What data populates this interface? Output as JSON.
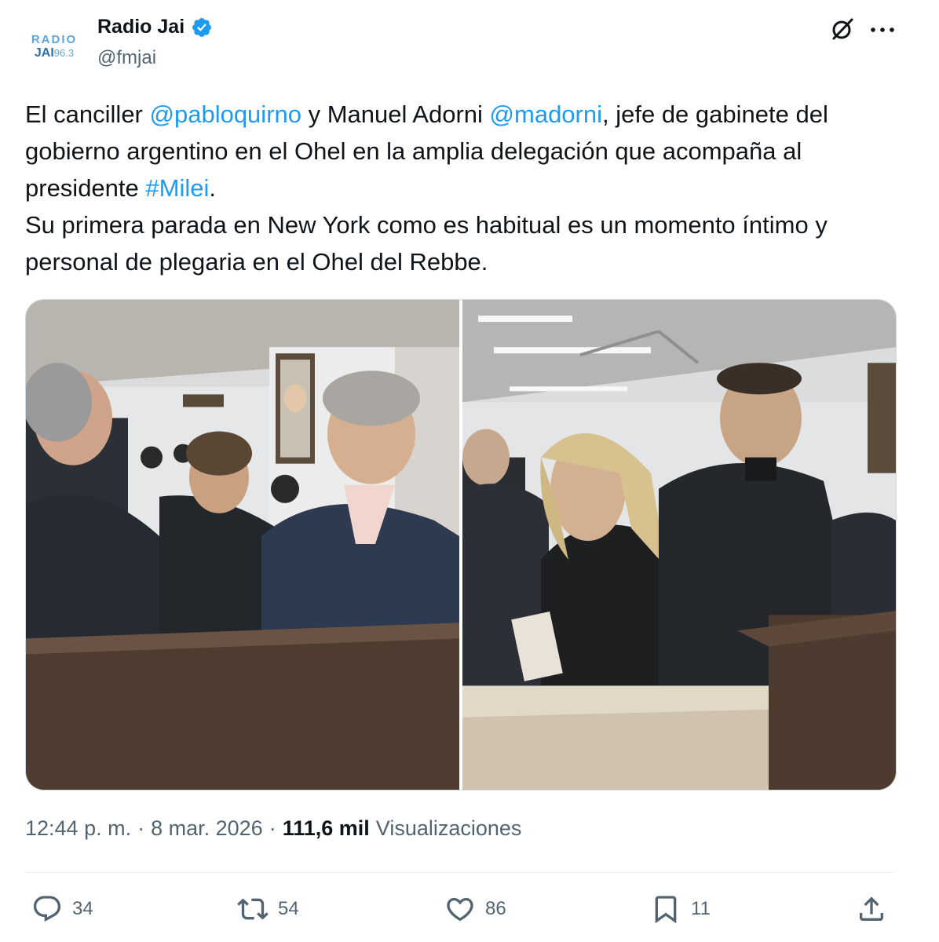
{
  "author": {
    "avatar_line1": "RADIO",
    "avatar_line2": "JAI",
    "avatar_freq": "96.3",
    "display_name": "Radio Jai",
    "handle": "@fmjai"
  },
  "tweet": {
    "t1": "El canciller ",
    "m1": "@pabloquirno",
    "t2": " y Manuel Adorni ",
    "m2": "@madorni",
    "t3": ", jefe de gabinete del gobierno argentino en el Ohel en la amplia delegación que acompaña al presidente ",
    "h1": "#Milei",
    "t4": ".",
    "p2": "Su primera parada en New York como es habitual es un momento íntimo y personal de plegaria en el Ohel del Rebbe."
  },
  "meta": {
    "time": "12:44 p. m.",
    "sep1": "·",
    "date": "8 mar. 2026",
    "sep2": "·",
    "views_count": "111,6 mil",
    "views_label": "Visualizaciones"
  },
  "actions": {
    "replies": "34",
    "reposts": "54",
    "likes": "86",
    "bookmarks": "11"
  },
  "colors": {
    "link": "#1d9bf0",
    "verified": "#1d9bf0",
    "secondary_text": "#536471"
  }
}
